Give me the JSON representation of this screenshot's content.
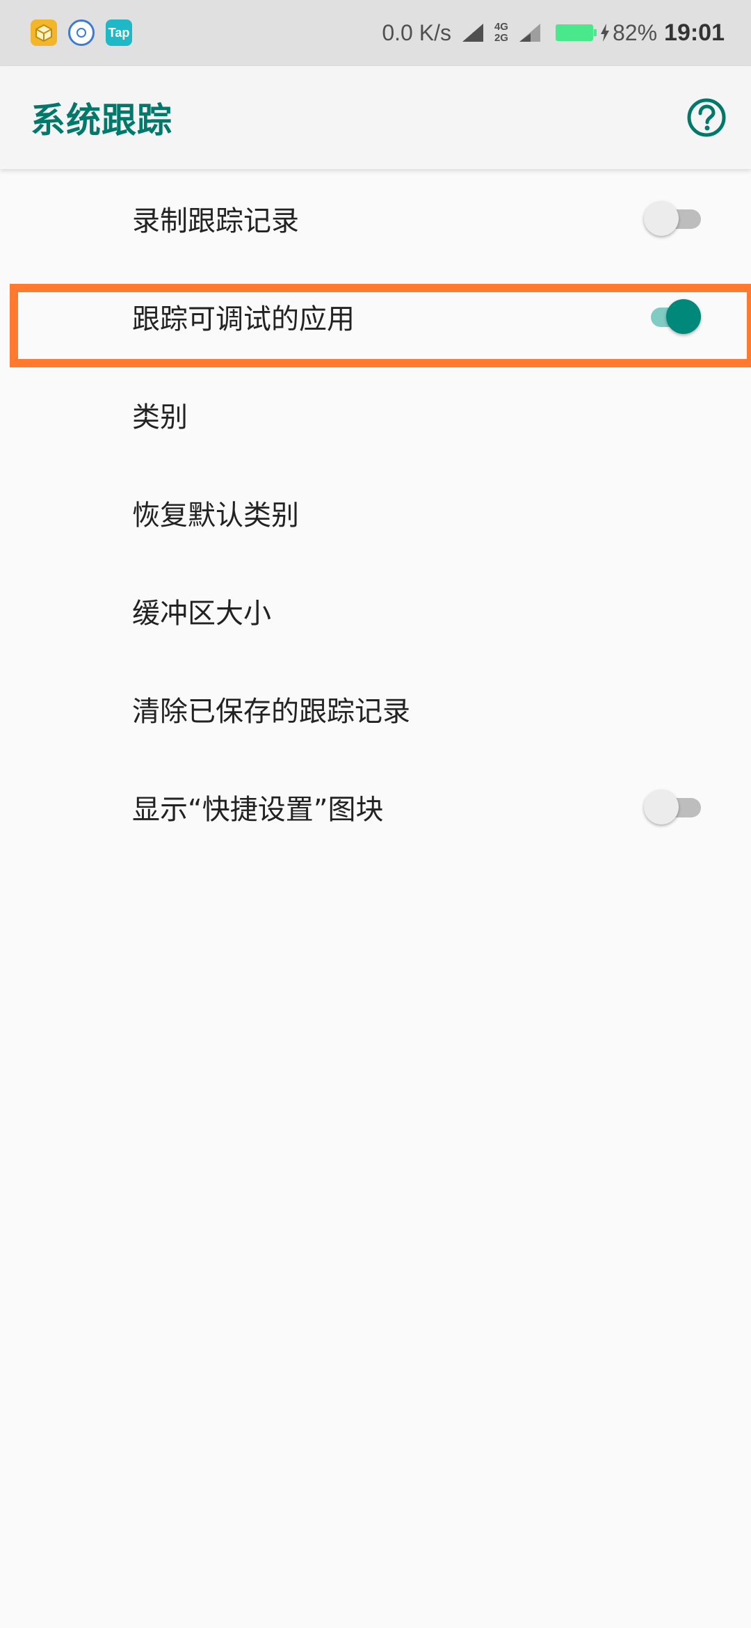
{
  "status_bar": {
    "net_speed": "0.0 K/s",
    "net_type_top": "4G",
    "net_type_bottom": "2G",
    "battery_percent": "82%",
    "time": "19:01",
    "tap_icon_label": "Tap",
    "icons": [
      "cube-app-icon",
      "ifly-app-icon",
      "tap-app-icon",
      "signal-icon",
      "battery-icon",
      "charging-icon"
    ]
  },
  "toolbar": {
    "title": "系统跟踪",
    "help_icon": "help-circle-icon"
  },
  "settings": {
    "items": [
      {
        "label": "录制跟踪记录",
        "has_switch": true,
        "checked": false
      },
      {
        "label": "跟踪可调试的应用",
        "has_switch": true,
        "checked": true
      },
      {
        "label": "类别",
        "has_switch": false
      },
      {
        "label": "恢复默认类别",
        "has_switch": false
      },
      {
        "label": "缓冲区大小",
        "has_switch": false
      },
      {
        "label": "清除已保存的跟踪记录",
        "has_switch": false
      },
      {
        "label": "显示“快捷设置”图块",
        "has_switch": true,
        "checked": false
      }
    ]
  },
  "colors": {
    "accent": "#00796b",
    "switch_on": "#00897b",
    "highlight": "#ff7a2f",
    "battery": "#49e88c"
  }
}
